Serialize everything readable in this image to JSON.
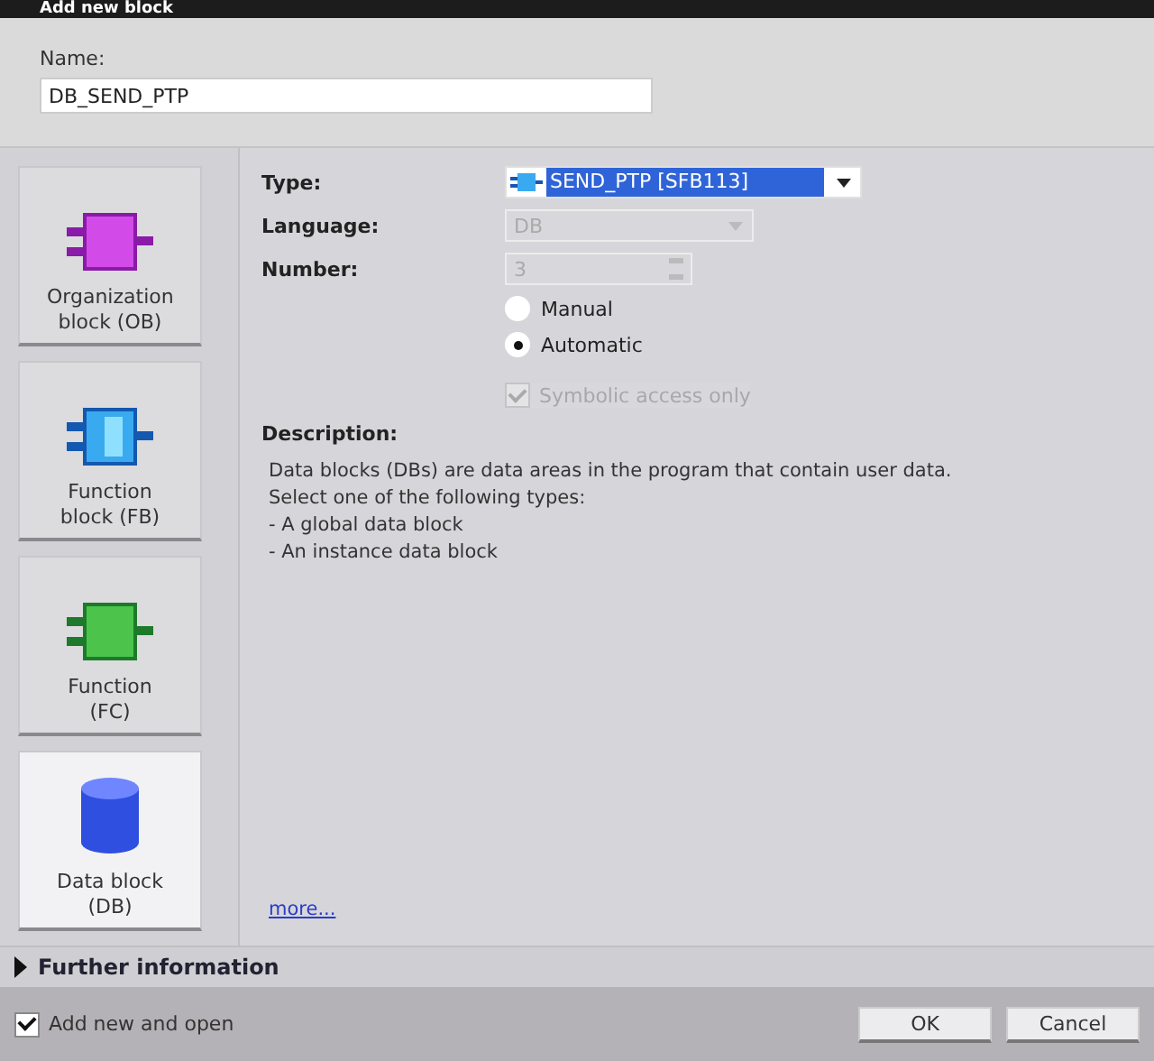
{
  "window": {
    "title": "Add new block"
  },
  "name_field": {
    "label": "Name:",
    "value": "DB_SEND_PTP"
  },
  "block_types": [
    {
      "kind": "ob",
      "label": "Organization block (OB)",
      "selected": false
    },
    {
      "kind": "fb",
      "label": "Function block (FB)",
      "selected": false
    },
    {
      "kind": "fc",
      "label": "Function (FC)",
      "selected": false
    },
    {
      "kind": "db",
      "label": "Data block (DB)",
      "selected": true
    }
  ],
  "type": {
    "label": "Type:",
    "value": "SEND_PTP [SFB113]"
  },
  "language": {
    "label": "Language:",
    "value": "DB",
    "disabled": true
  },
  "number": {
    "label": "Number:",
    "value": "3",
    "disabled": true
  },
  "numbering": [
    {
      "label": "Manual",
      "selected": false
    },
    {
      "label": "Automatic",
      "selected": true
    }
  ],
  "symbolic_access": {
    "label": "Symbolic access only",
    "checked": true,
    "disabled": true
  },
  "description": {
    "label": "Description:",
    "lines": [
      "Data blocks (DBs) are data areas in the program that contain user data.",
      "Select one of the following types:",
      "- A global data block",
      "- An instance data block"
    ]
  },
  "more_link": "more...",
  "further_information": {
    "label": "Further information",
    "expanded": false
  },
  "add_new_and_open": {
    "label": "Add new and open",
    "checked": true
  },
  "buttons": [
    "OK",
    "Cancel"
  ]
}
